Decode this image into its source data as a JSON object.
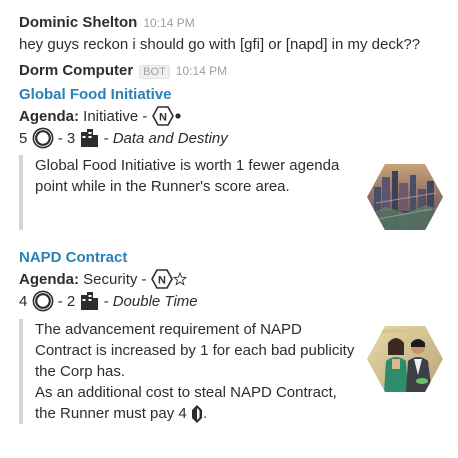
{
  "msg1": {
    "author": "Dominic Shelton",
    "time": "10:14 PM",
    "text": "hey guys reckon i should go with [gfi] or [napd] in my deck??"
  },
  "msg2": {
    "author": "Dorm Computer",
    "badge": "BOT",
    "time": "10:14 PM"
  },
  "cards": [
    {
      "title": "Global Food Initiative",
      "type_label": "Agenda:",
      "subtype": "Initiative -",
      "advance": "5",
      "points": "- 3",
      "set": "- Data and Destiny",
      "text": [
        "Global Food Initiative is worth 1 fewer agenda",
        "point while in the Runner's score area."
      ],
      "faction_icon": "nbn-icon",
      "influence_icon": "influence-dot-icon",
      "art": "city-skyline-art"
    },
    {
      "title": "NAPD Contract",
      "type_label": "Agenda:",
      "subtype": "Security -",
      "advance": "4",
      "points": "- 2",
      "set": "- Double Time",
      "text": [
        "The advancement requirement of NAPD",
        "Contract is increased by 1 for each bad publicity",
        "the Corp has.",
        "As an additional cost to steal NAPD Contract,",
        "the Runner must pay 4",
        "."
      ],
      "faction_icon": "nbn-icon",
      "influence_icon": "star-outline-icon",
      "art": "two-people-art"
    }
  ]
}
